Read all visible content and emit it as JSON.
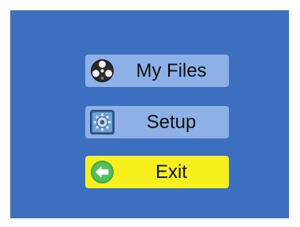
{
  "colors": {
    "screen_background": "#3c6fc0",
    "item_background": "#8db0e6",
    "selected_item_background": "#f7ef1e"
  },
  "menu": {
    "items": [
      {
        "label": "My Files",
        "icon": "film-reel-icon",
        "selected": false
      },
      {
        "label": "Setup",
        "icon": "settings-gear-icon",
        "selected": false
      },
      {
        "label": "Exit",
        "icon": "back-arrow-icon",
        "selected": true
      }
    ]
  }
}
